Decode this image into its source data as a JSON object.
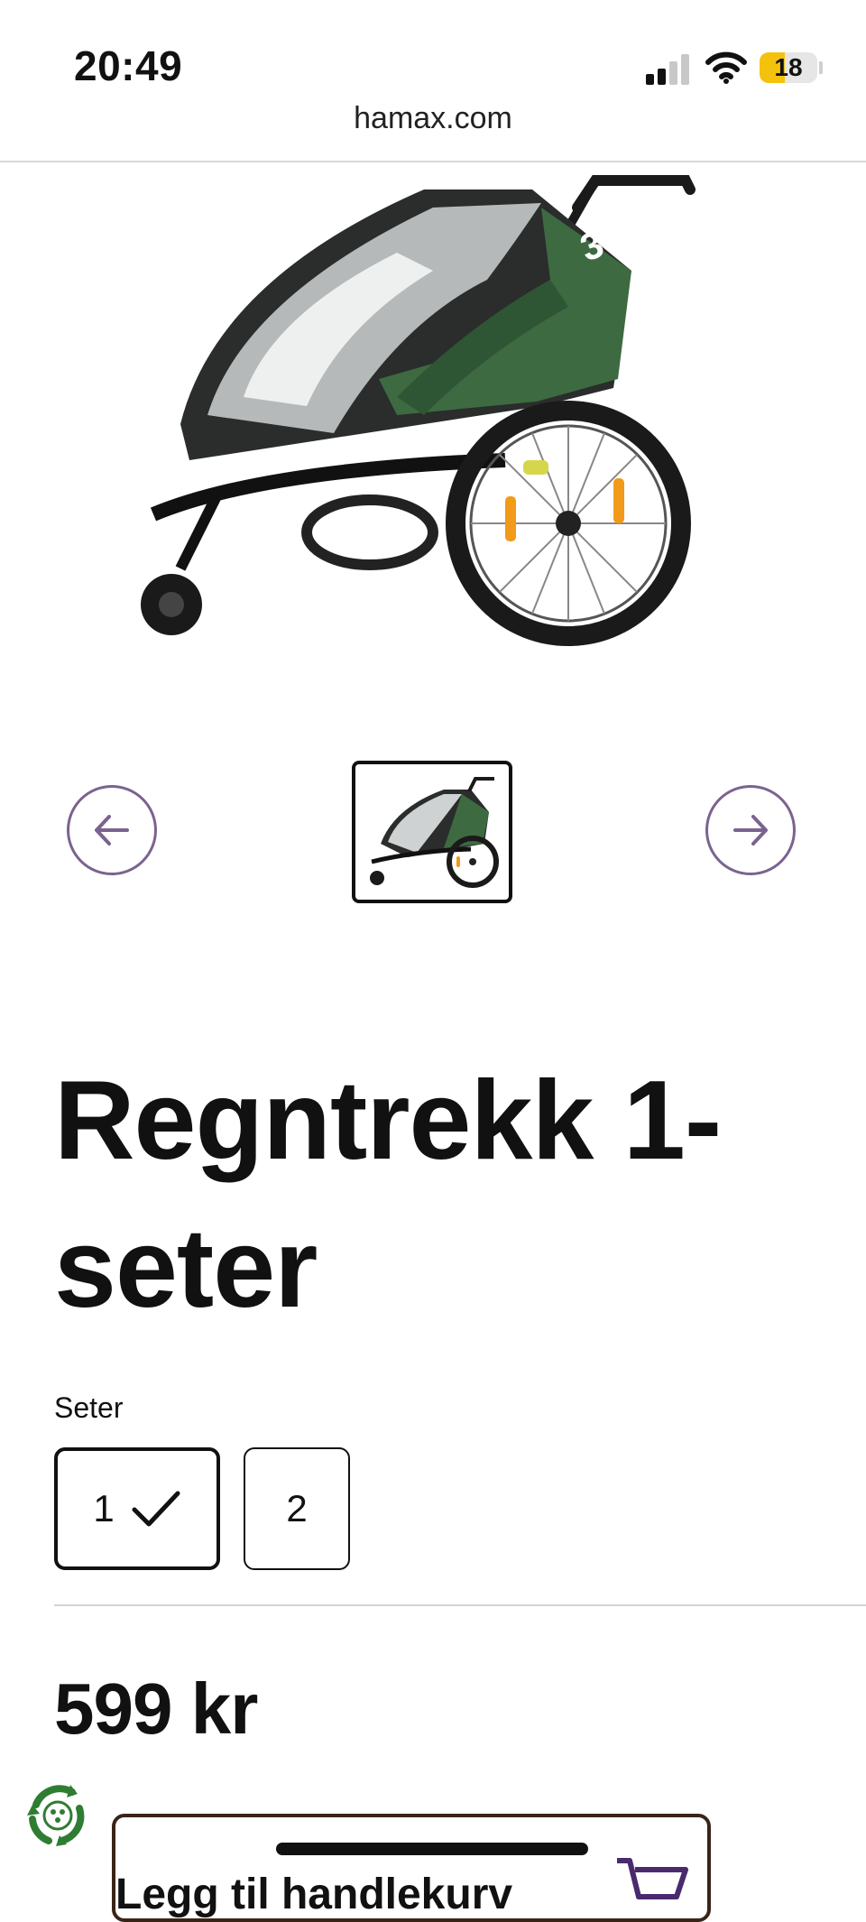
{
  "status_bar": {
    "time": "20:49",
    "battery_level": "18",
    "battery_color": "#f4c20d",
    "icons": [
      "signal-icon",
      "wifi-icon",
      "battery-icon"
    ]
  },
  "browser": {
    "url": "hamax.com"
  },
  "gallery": {
    "hero_alt": "product-image",
    "prev_icon": "arrow-left-icon",
    "next_icon": "arrow-right-icon",
    "accent_color": "#7b6390"
  },
  "product": {
    "title": "Regntrekk 1-\nseter",
    "variant_label": "Seter",
    "variant_options": [
      "1",
      "2"
    ],
    "selected_variant": "1",
    "price": "599 kr",
    "add_to_cart_label": "Legg til handlekurv",
    "cart_icon_color": "#4a2a6e"
  }
}
